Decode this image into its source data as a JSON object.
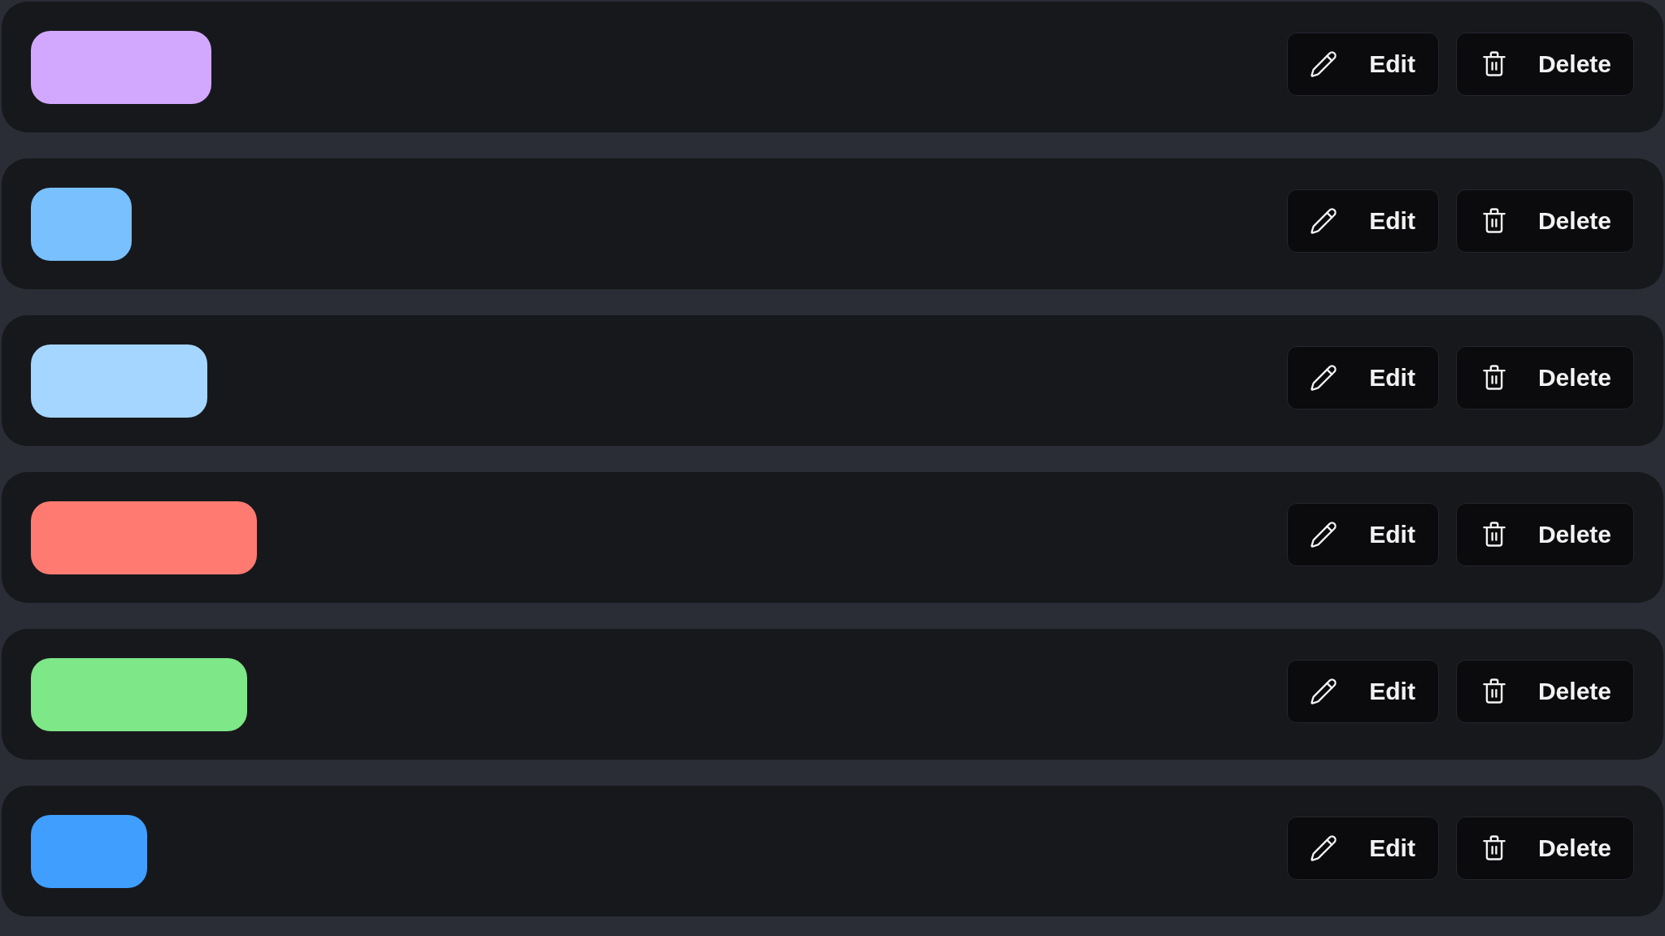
{
  "items": [
    {
      "color": "#d2a8ff",
      "buttons": [
        {
          "kind": "edit",
          "label": "Edit"
        },
        {
          "kind": "delete",
          "label": "Delete"
        }
      ]
    },
    {
      "color": "#79c0ff",
      "buttons": [
        {
          "kind": "edit",
          "label": "Edit"
        },
        {
          "kind": "delete",
          "label": "Delete"
        }
      ]
    },
    {
      "color": "#a5d6ff",
      "buttons": [
        {
          "kind": "edit",
          "label": "Edit"
        },
        {
          "kind": "delete",
          "label": "Delete"
        }
      ]
    },
    {
      "color": "#ff7b72",
      "buttons": [
        {
          "kind": "edit",
          "label": "Edit"
        },
        {
          "kind": "delete",
          "label": "Delete"
        }
      ]
    },
    {
      "color": "#7ee787",
      "buttons": [
        {
          "kind": "edit",
          "label": "Edit"
        },
        {
          "kind": "delete",
          "label": "Delete"
        }
      ]
    },
    {
      "color": "#409eff",
      "buttons": [
        {
          "kind": "edit",
          "label": "Edit"
        },
        {
          "kind": "delete",
          "label": "Delete"
        }
      ]
    }
  ]
}
